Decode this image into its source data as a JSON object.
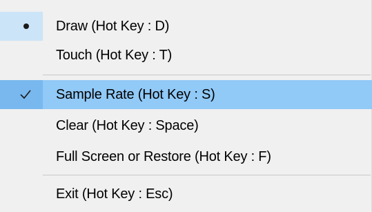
{
  "menu": {
    "items": [
      {
        "label": "Draw (Hot Key : D)",
        "state": "radio-selected",
        "icon": "bullet-icon"
      },
      {
        "label": "Touch (Hot Key : T)",
        "state": "normal"
      },
      {
        "label": "Sample Rate (Hot Key : S)",
        "state": "checked-highlighted",
        "icon": "check-icon"
      },
      {
        "label": "Clear (Hot Key : Space)",
        "state": "normal"
      },
      {
        "label": "Full Screen or Restore (Hot Key : F)",
        "state": "normal"
      },
      {
        "label": "Exit (Hot Key : Esc)",
        "state": "normal"
      }
    ]
  },
  "colors": {
    "menu_background": "#f0f0f0",
    "highlight": "#91c9f7",
    "highlight_gutter": "#78b8ee",
    "radio_gutter": "#cce4f7",
    "separator": "#c8c8c8"
  }
}
